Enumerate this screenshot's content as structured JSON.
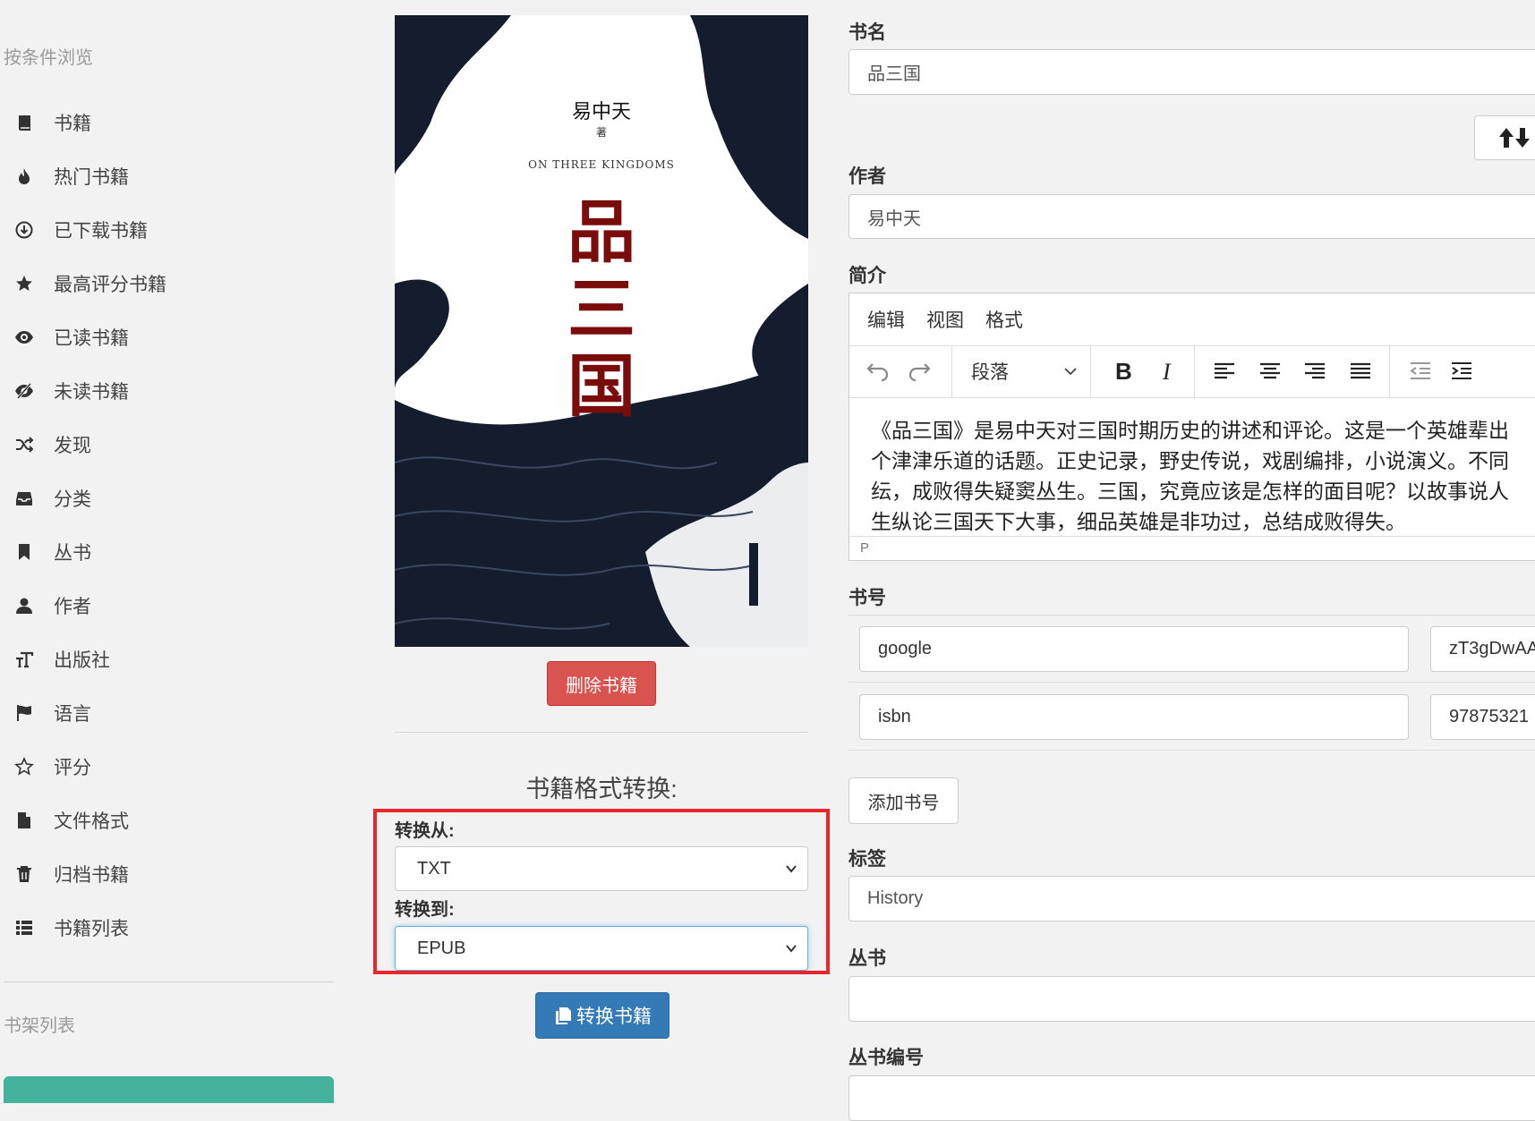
{
  "sidebar": {
    "browse_heading": "按条件浏览",
    "items": [
      {
        "label": "书籍",
        "icon": "book-icon"
      },
      {
        "label": "热门书籍",
        "icon": "fire-icon"
      },
      {
        "label": "已下载书籍",
        "icon": "download-circle-icon"
      },
      {
        "label": "最高评分书籍",
        "icon": "star-filled-icon"
      },
      {
        "label": "已读书籍",
        "icon": "eye-icon"
      },
      {
        "label": "未读书籍",
        "icon": "eye-slash-icon"
      },
      {
        "label": "发现",
        "icon": "shuffle-icon"
      },
      {
        "label": "分类",
        "icon": "inbox-icon"
      },
      {
        "label": "丛书",
        "icon": "bookmark-icon"
      },
      {
        "label": "作者",
        "icon": "user-icon"
      },
      {
        "label": "出版社",
        "icon": "text-size-icon"
      },
      {
        "label": "语言",
        "icon": "flag-icon"
      },
      {
        "label": "评分",
        "icon": "star-outline-icon"
      },
      {
        "label": "文件格式",
        "icon": "file-icon"
      },
      {
        "label": "归档书籍",
        "icon": "trash-icon"
      },
      {
        "label": "书籍列表",
        "icon": "list-icon"
      }
    ],
    "shelf_heading": "书架列表"
  },
  "cover": {
    "author": "易中天",
    "zhu": "著",
    "english": "ON THREE KINGDOMS",
    "title_chars": [
      "品",
      "三",
      "国"
    ]
  },
  "actions": {
    "delete_label": "删除书籍",
    "convert_title": "书籍格式转换:",
    "from_label": "转换从:",
    "from_value": "TXT",
    "to_label": "转换到:",
    "to_value": "EPUB",
    "convert_button": "转换书籍"
  },
  "form": {
    "title_label": "书名",
    "title_value": "品三国",
    "author_label": "作者",
    "author_value": "易中天",
    "desc_label": "简介",
    "editor": {
      "menus": [
        "编辑",
        "视图",
        "格式"
      ],
      "block_format": "段落",
      "content_lines": [
        "《品三国》是易中天对三国时期历史的讲述和评论。这是一个英雄辈出",
        "个津津乐道的话题。正史记录，野史传说，戏剧编排，小说演义。不同",
        "纭，成败得失疑窦丛生。三国，究竟应该是怎样的面目呢？以故事说人",
        "生纵论三国天下大事，细品英雄是非功过，总结成败得失。"
      ],
      "status_path": "P"
    },
    "identifiers_label": "书号",
    "identifiers": [
      {
        "type": "google",
        "value": "zT3gDwAA"
      },
      {
        "type": "isbn",
        "value": "97875321"
      }
    ],
    "add_identifier": "添加书号",
    "tags_label": "标签",
    "tags_value": "History",
    "series_label": "丛书",
    "series_value": "",
    "series_index_label": "丛书编号"
  },
  "colors": {
    "danger": "#d9534f",
    "primary": "#337ab7",
    "highlight_box": "#e8262b",
    "shelf_button": "#45b29d"
  }
}
